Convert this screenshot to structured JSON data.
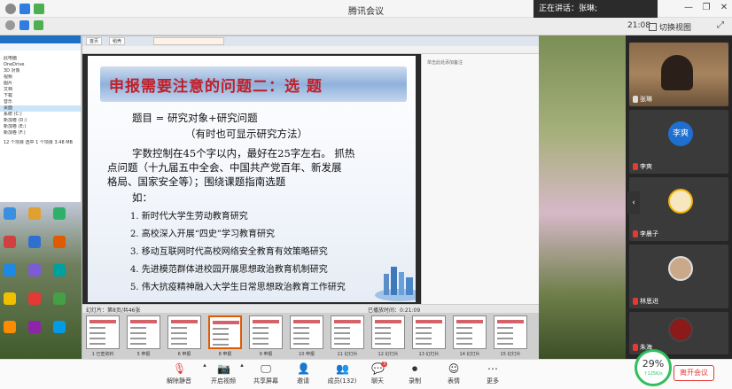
{
  "app": {
    "title": "腾讯会议"
  },
  "speaker": {
    "text": "正在讲话：张琳;"
  },
  "clock": {
    "time": "21:08"
  },
  "view_switch": {
    "label": "切换视图"
  },
  "explorer": {
    "rows": [
      "此电脑",
      "OneDrive",
      "3D 对象",
      "视频",
      "图片",
      "文档",
      "下载",
      "音乐",
      "桌面",
      "系统 (C:)",
      "新加卷 (D:)",
      "新加卷 (E:)",
      "新加卷 (F:)",
      "12 个项目  选中 1 个项目 3.48 MB"
    ]
  },
  "ppt": {
    "tabs": [
      "首页",
      "稻壳"
    ],
    "notes_label": "单击此处添加备注",
    "status_left": "幻灯片：第8页/共46张",
    "status_right": "已播放时间：0:21:09",
    "thumbnail_labels": [
      "1 已查资料",
      "5 申报",
      "6 申报",
      "8 申报",
      "9 申报",
      "10 申报",
      "11 幻灯片",
      "12 幻灯片",
      "13 幻灯片",
      "14 幻灯片",
      "15 幻灯片"
    ]
  },
  "slide": {
    "title": "申报需要注意的问题二：选 题",
    "line1": "题目 = 研究对象+研究问题",
    "line2": "（有时也可显示研究方法）",
    "line3": "字数控制在45个字以内，最好在25字左右。 抓热",
    "line4": "点问题（十九届五中全会、中国共产党百年、新发展",
    "line5": "格局、国家安全等）；围绕课题指南选题",
    "line6": "如：",
    "list": [
      "1. 新时代大学生劳动教育研究",
      "2. 高校深入开展“四史”学习教育研究",
      "3. 移动互联网时代高校网络安全教育有效策略研究",
      "4. 先进模范群体进校园开展思想政治教育机制研究",
      "5. 伟大抗疫精神融入大学生日常思想政治教育工作研究"
    ]
  },
  "participants": [
    {
      "name": "张琳"
    },
    {
      "name": "李爽",
      "avatar_text": "李爽"
    },
    {
      "name": "李晨子"
    },
    {
      "name": "林思进"
    },
    {
      "name": "朱海"
    }
  ],
  "toolbar": {
    "mute": "解除静音",
    "video": "开启视频",
    "share": "共享屏幕",
    "invite": "邀请",
    "members": "成员(132)",
    "chat": "聊天",
    "chat_badge": "3",
    "record": "录制",
    "emoji": "表情",
    "more": "更多"
  },
  "network": {
    "percent": "29%",
    "speed": "↑125K/s"
  },
  "leave": {
    "label": "离开会议"
  }
}
